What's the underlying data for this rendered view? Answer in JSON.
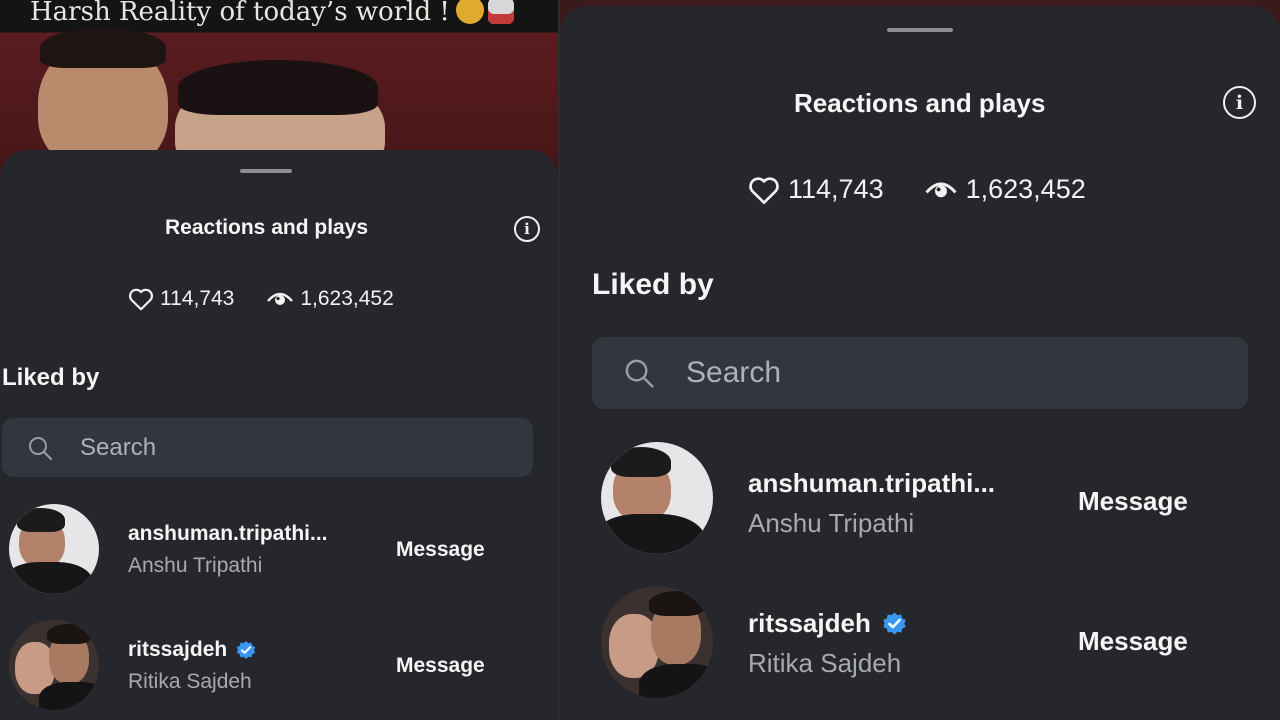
{
  "story": {
    "caption": "Harsh Reality of today’s world !"
  },
  "sheet": {
    "title": "Reactions and plays",
    "likes_count": "114,743",
    "plays_count": "1,623,452",
    "liked_by_label": "Liked by",
    "search_placeholder": "Search"
  },
  "likers": [
    {
      "username": "anshuman.tripathi...",
      "full_name": "Anshu Tripathi",
      "verified": false,
      "action_label": "Message"
    },
    {
      "username": "ritssajdeh",
      "full_name": "Ritika Sajdeh",
      "verified": true,
      "action_label": "Message"
    }
  ],
  "colors": {
    "sheet_background": "#26272c",
    "verified_badge": "#3897f0",
    "secondary_text": "#a7aab0"
  },
  "icons": [
    "heart-icon",
    "eye-icon",
    "info-icon",
    "search-icon",
    "verified-badge-icon"
  ]
}
